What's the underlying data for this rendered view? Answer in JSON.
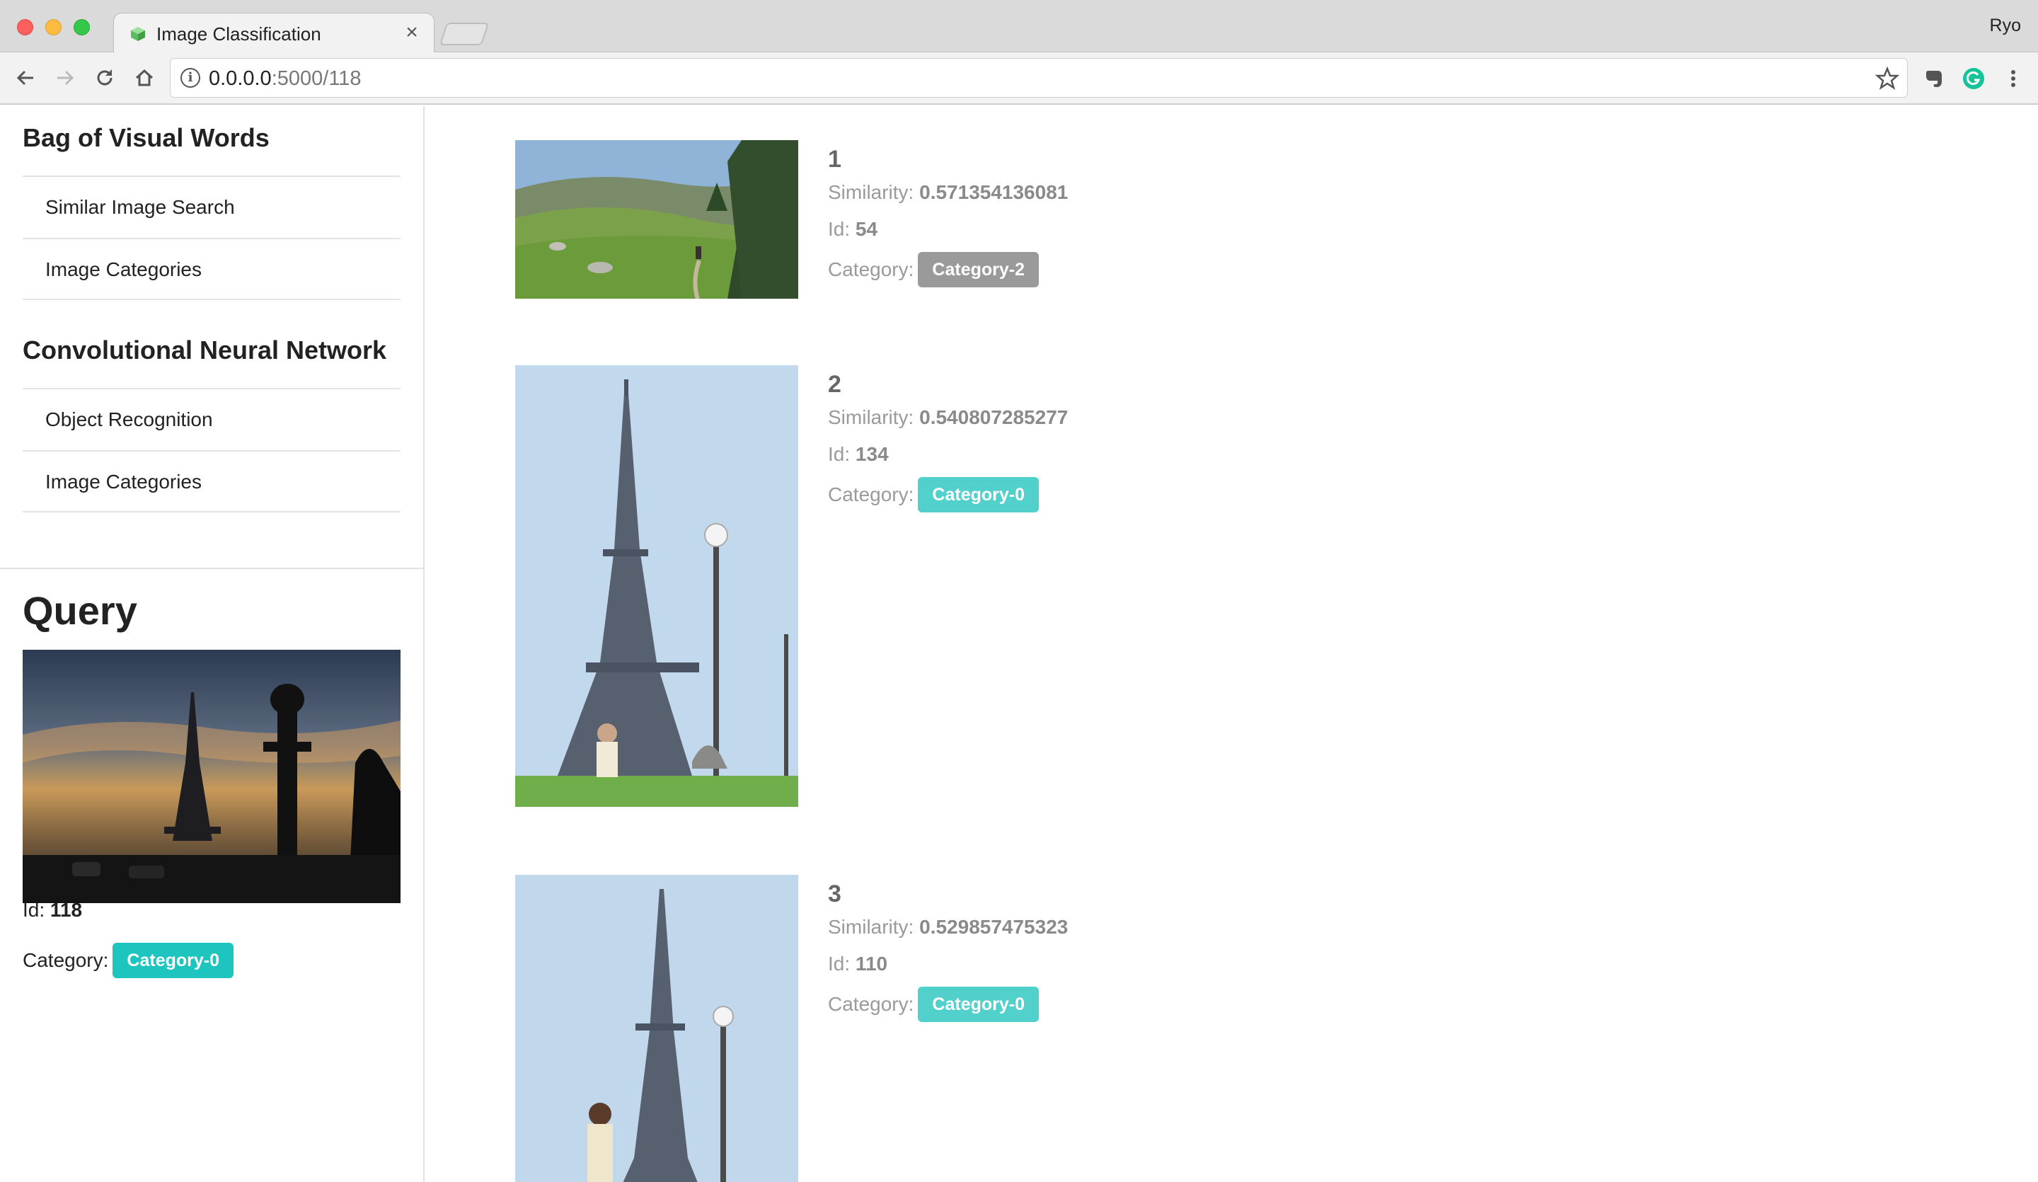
{
  "browser": {
    "tab_title": "Image Classification",
    "tab_close": "×",
    "url_host": "0.0.0.0",
    "url_path": ":5000/118",
    "profile_name": "Ryo"
  },
  "sidebar": {
    "sections": [
      {
        "title": "Bag of Visual Words",
        "items": [
          "Similar Image Search",
          "Image Categories"
        ]
      },
      {
        "title": "Convolutional Neural Network",
        "items": [
          "Object Recognition",
          "Image Categories"
        ]
      }
    ],
    "query": {
      "title": "Query",
      "id_label": "Id:",
      "id": "118",
      "category_label": "Category:",
      "category": "Category-0",
      "image": "eiffel-tower-sunset-silhouette"
    }
  },
  "results": [
    {
      "rank": "1",
      "similarity_label": "Similarity:",
      "similarity": "0.571354136081",
      "id_label": "Id:",
      "id": "54",
      "category_label": "Category:",
      "category": "Category-2",
      "category_color": "#9a9a9a",
      "image": "mountain-meadow-hiker"
    },
    {
      "rank": "2",
      "similarity_label": "Similarity:",
      "similarity": "0.540807285277",
      "id_label": "Id:",
      "id": "134",
      "category_label": "Category:",
      "category": "Category-0",
      "category_color": "#52d0cb",
      "image": "eiffel-tower-man-sitting"
    },
    {
      "rank": "3",
      "similarity_label": "Similarity:",
      "similarity": "0.529857475323",
      "id_label": "Id:",
      "id": "110",
      "category_label": "Category:",
      "category": "Category-0",
      "category_color": "#52d0cb",
      "image": "eiffel-tower-woman-standing"
    }
  ],
  "colors": {
    "teal": "#1ec4be",
    "teal_light": "#52d0cb",
    "gray_badge": "#9a9a9a"
  }
}
